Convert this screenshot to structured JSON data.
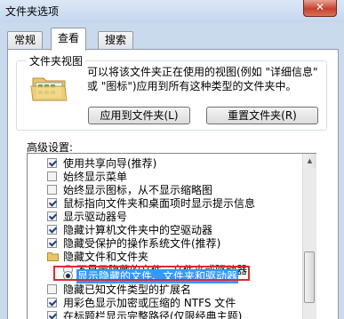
{
  "window": {
    "title": "文件夹选项",
    "close_label": "✕"
  },
  "tabs": [
    {
      "label": "常规",
      "active": false
    },
    {
      "label": "查看",
      "active": true
    },
    {
      "label": "搜索",
      "active": false
    }
  ],
  "folder_views": {
    "legend": "文件夹视图",
    "description": "可以将该文件夹正在使用的视图(例如 \"详细信息\" 或 \"图标\")应用到所有这种类型的文件夹中。",
    "apply_button": "应用到文件夹(L)",
    "reset_button": "重置文件夹(R)"
  },
  "advanced": {
    "label": "高级设置:",
    "items": [
      {
        "type": "checkbox",
        "checked": true,
        "label": "使用共享向导(推荐)"
      },
      {
        "type": "checkbox",
        "checked": false,
        "label": "始终显示菜单"
      },
      {
        "type": "checkbox",
        "checked": false,
        "label": "始终显示图标，从不显示缩略图"
      },
      {
        "type": "checkbox",
        "checked": true,
        "label": "鼠标指向文件夹和桌面项时显示提示信息"
      },
      {
        "type": "checkbox",
        "checked": true,
        "label": "显示驱动器号"
      },
      {
        "type": "checkbox",
        "checked": true,
        "label": "隐藏计算机文件夹中的空驱动器"
      },
      {
        "type": "checkbox",
        "checked": true,
        "label": "隐藏受保护的操作系统文件(推荐)"
      },
      {
        "type": "folder",
        "label": "隐藏文件和文件夹"
      },
      {
        "type": "radio",
        "checked": false,
        "label": "不显示隐藏的文件、文件夹或驱动器"
      },
      {
        "type": "radio",
        "checked": true,
        "label": "显示隐藏的文件、文件夹和驱动器",
        "selected": true
      },
      {
        "type": "checkbox",
        "checked": false,
        "label": "隐藏已知文件类型的扩展名"
      },
      {
        "type": "checkbox",
        "checked": true,
        "label": "用彩色显示加密或压缩的 NTFS 文件"
      },
      {
        "type": "checkbox",
        "checked": true,
        "label": "在标题栏显示完整路径(仅限经典主题)"
      }
    ]
  },
  "colors": {
    "highlight_border": "#e0292e",
    "selection_bg": "#3399ff"
  }
}
